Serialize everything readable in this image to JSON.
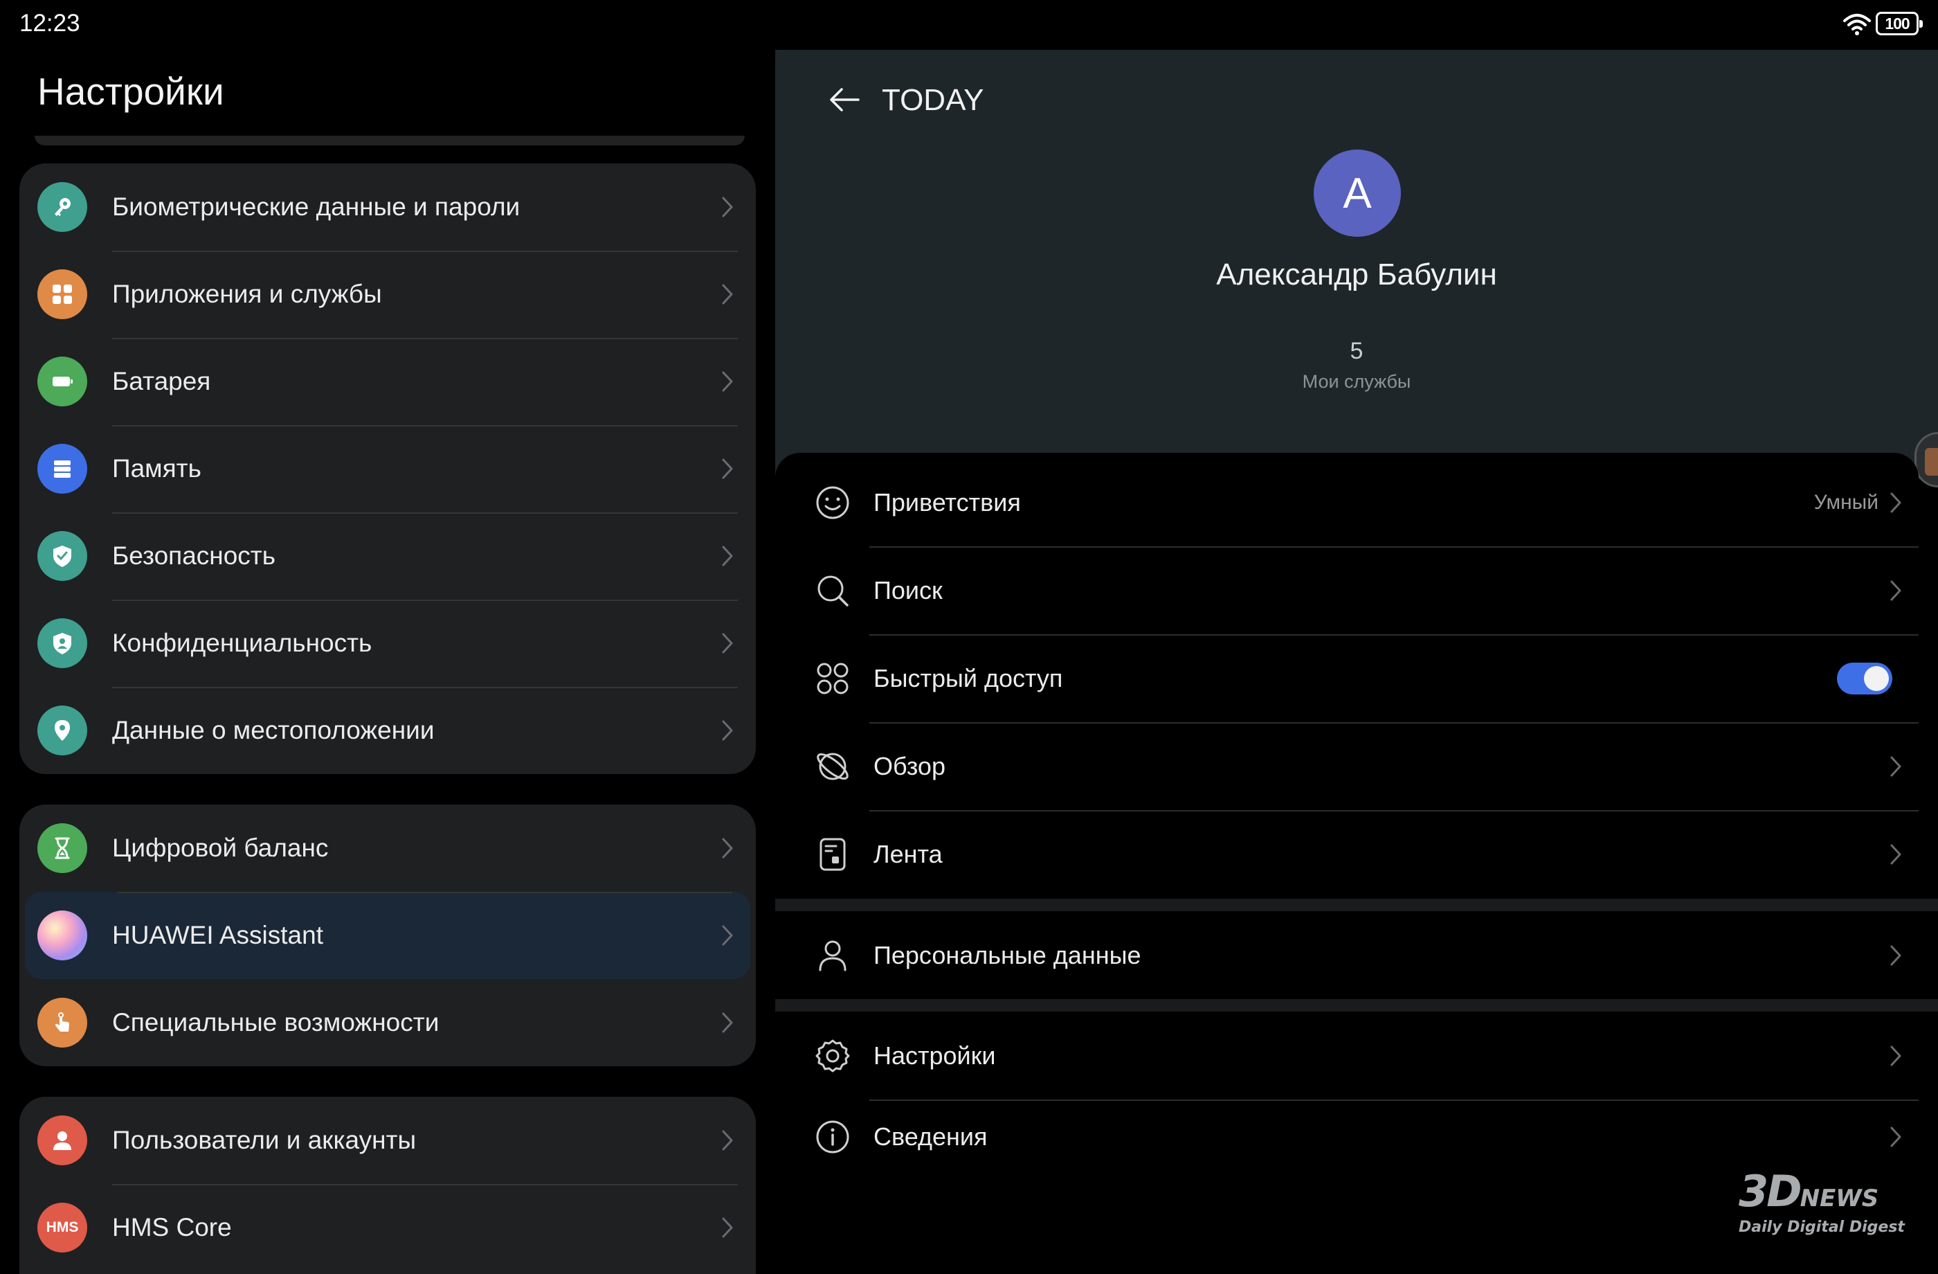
{
  "status_bar": {
    "time": "12:23",
    "battery": "100",
    "icons": [
      "wifi-icon",
      "battery-icon"
    ]
  },
  "settings": {
    "title": "Настройки",
    "groups": [
      {
        "items": [
          {
            "label": "Биометрические данные и пароли",
            "icon": "key-icon",
            "color": "#3fa08f"
          },
          {
            "label": "Приложения и службы",
            "icon": "apps-grid-icon",
            "color": "#e08a47"
          },
          {
            "label": "Батарея",
            "icon": "battery-icon",
            "color": "#4caa58"
          },
          {
            "label": "Память",
            "icon": "storage-icon",
            "color": "#3d6ee5"
          },
          {
            "label": "Безопасность",
            "icon": "shield-check-icon",
            "color": "#3fa08f"
          },
          {
            "label": "Конфиденциальность",
            "icon": "privacy-shield-icon",
            "color": "#3fa08f"
          },
          {
            "label": "Данные о местоположении",
            "icon": "location-pin-icon",
            "color": "#3fa08f"
          }
        ]
      },
      {
        "items": [
          {
            "label": "Цифровой баланс",
            "icon": "hourglass-icon",
            "color": "#4caa58"
          },
          {
            "label": "HUAWEI Assistant",
            "icon": "assistant-orb-icon",
            "color": "#c08be0",
            "selected": true
          },
          {
            "label": "Специальные возможности",
            "icon": "hand-touch-icon",
            "color": "#e08a47"
          }
        ]
      },
      {
        "items": [
          {
            "label": "Пользователи и аккаунты",
            "icon": "user-icon",
            "color": "#e05a4a"
          },
          {
            "label": "HMS Core",
            "icon": "hms-icon",
            "icon_text": "HMS",
            "color": "#e05a4a"
          }
        ]
      }
    ]
  },
  "today": {
    "title": "TODAY",
    "avatar_letter": "А",
    "avatar_color": "#5b63c0",
    "user_name": "Александр Бабулин",
    "services_count": "5",
    "services_label": "Мои службы",
    "items": [
      {
        "label": "Приветствия",
        "icon": "smile-icon",
        "value": "Умный"
      },
      {
        "label": "Поиск",
        "icon": "search-icon"
      },
      {
        "label": "Быстрый доступ",
        "icon": "quick-access-icon",
        "toggle": true,
        "toggle_on": true
      },
      {
        "label": "Обзор",
        "icon": "overview-planet-icon"
      },
      {
        "label": "Лента",
        "icon": "feed-icon"
      },
      {
        "label": "Персональные данные",
        "icon": "person-icon"
      },
      {
        "label": "Настройки",
        "icon": "gear-icon"
      },
      {
        "label": "Сведения",
        "icon": "info-icon"
      }
    ]
  },
  "watermark": {
    "main": "3D",
    "news": "NEWS",
    "sub": "Daily Digital Digest"
  },
  "colors": {
    "accent": "#3e6fe6",
    "panel_bg": "#1f2022",
    "profile_bg": "#1e2629",
    "selected_bg": "#1b2838"
  }
}
